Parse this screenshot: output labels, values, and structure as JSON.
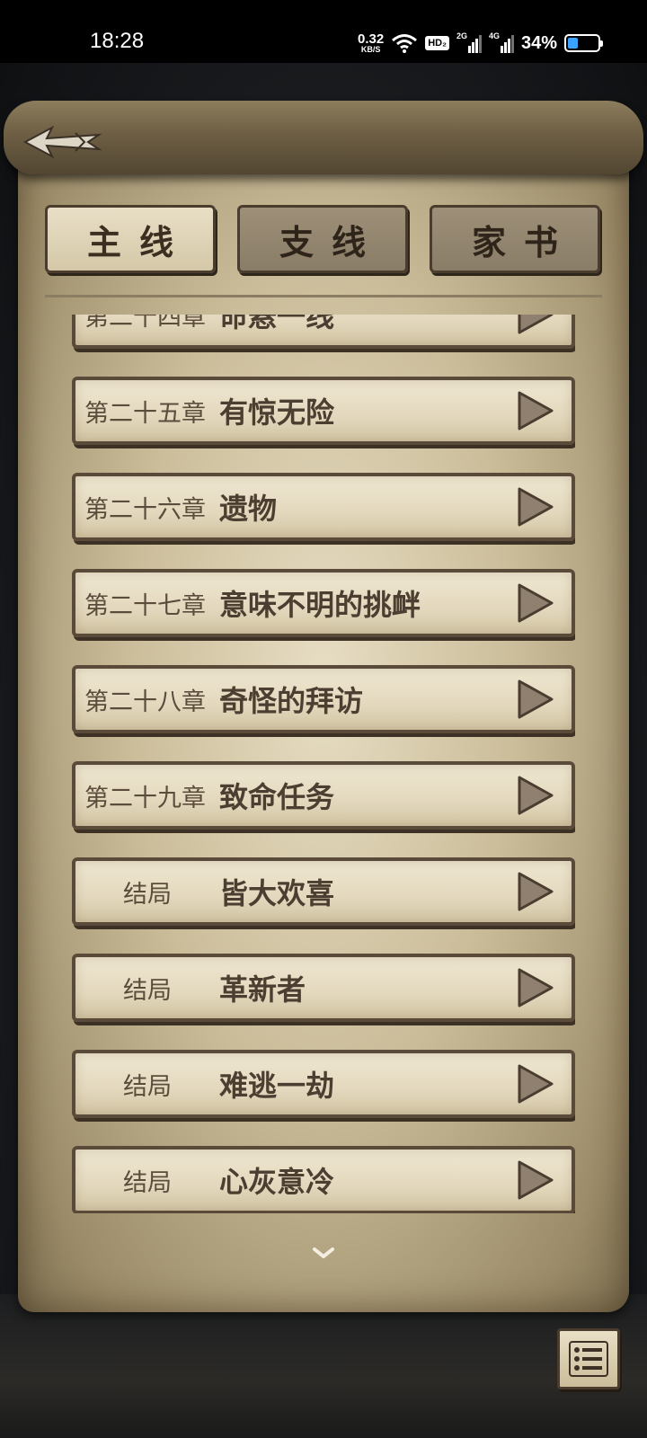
{
  "status_bar": {
    "time": "18:28",
    "net_speed": "0.32",
    "net_unit": "KB/S",
    "hd_badge": "HD₂",
    "signal_1": "2G",
    "signal_2": "4G",
    "battery": "34%",
    "battery_level": 0.34
  },
  "header": {
    "back_icon": "arrow-left-icon"
  },
  "tabs": [
    {
      "label": "主线",
      "active": true
    },
    {
      "label": "支线",
      "active": false
    },
    {
      "label": "家书",
      "active": false
    }
  ],
  "chapters": [
    {
      "number": "第二十四章",
      "title": "命悬一线"
    },
    {
      "number": "第二十五章",
      "title": "有惊无险"
    },
    {
      "number": "第二十六章",
      "title": "遗物"
    },
    {
      "number": "第二十七章",
      "title": "意味不明的挑衅"
    },
    {
      "number": "第二十八章",
      "title": "奇怪的拜访"
    },
    {
      "number": "第二十九章",
      "title": "致命任务"
    },
    {
      "number": "结局",
      "title": "皆大欢喜"
    },
    {
      "number": "结局",
      "title": "革新者"
    },
    {
      "number": "结局",
      "title": "难逃一劫"
    },
    {
      "number": "结局",
      "title": "心灰意冷"
    }
  ],
  "icons": {
    "play": "play-triangle-icon",
    "scroll_down": "chevron-down-icon",
    "menu": "list-menu-icon"
  }
}
